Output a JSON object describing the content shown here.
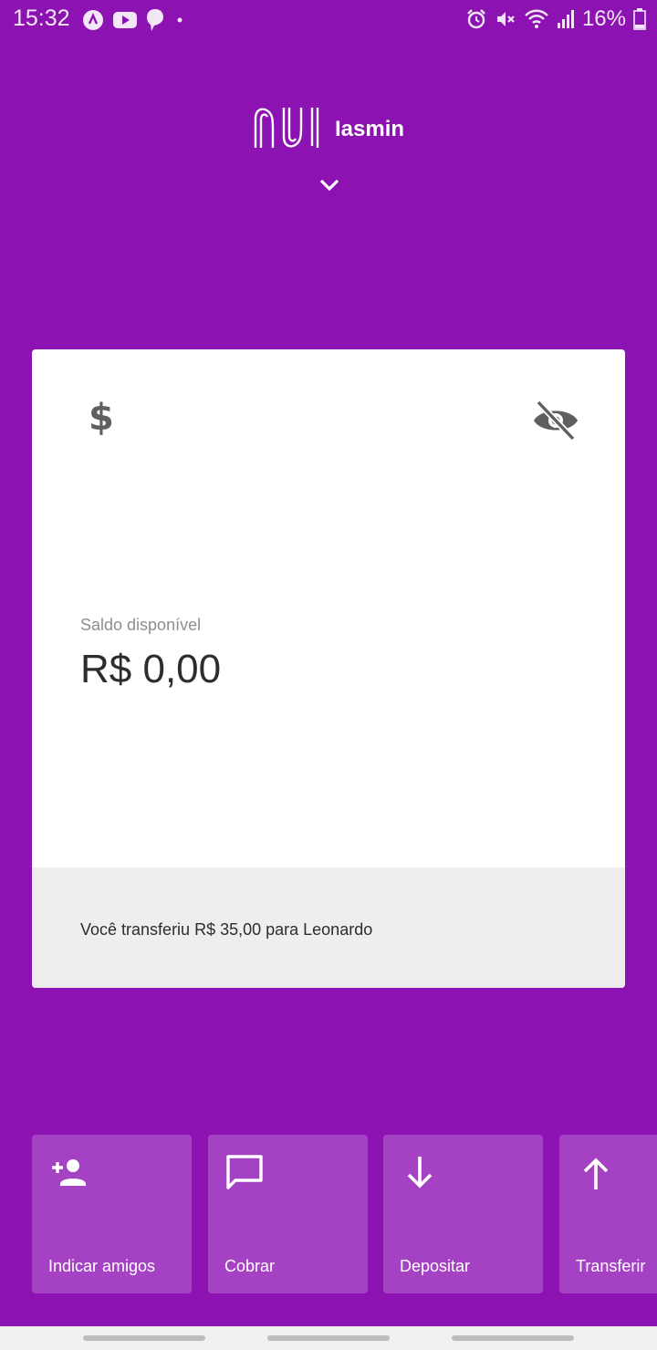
{
  "status_bar": {
    "time": "15:32",
    "battery": "16%",
    "left_icons": [
      "app-notification-icon",
      "youtube-icon",
      "notification-icon",
      "dot-icon"
    ],
    "right_icons": [
      "alarm-icon",
      "mute-icon",
      "wifi-icon",
      "signal-icon",
      "battery-icon"
    ]
  },
  "header": {
    "logo": "nu",
    "user_name": "Iasmin"
  },
  "balance_card": {
    "label": "Saldo disponível",
    "value": "R$ 0,00",
    "recent_activity": "Você transferiu R$ 35,00 para Leonardo"
  },
  "shortcuts": [
    {
      "label": "Indicar amigos",
      "icon": "add-person-icon"
    },
    {
      "label": "Cobrar",
      "icon": "chat-icon"
    },
    {
      "label": "Depositar",
      "icon": "arrow-down-icon"
    },
    {
      "label": "Transferir",
      "icon": "arrow-up-icon"
    }
  ],
  "colors": {
    "background": "#8c12b2",
    "shortcut": "#a542c4",
    "card": "#ffffff",
    "card_footer": "#eeeeee"
  }
}
